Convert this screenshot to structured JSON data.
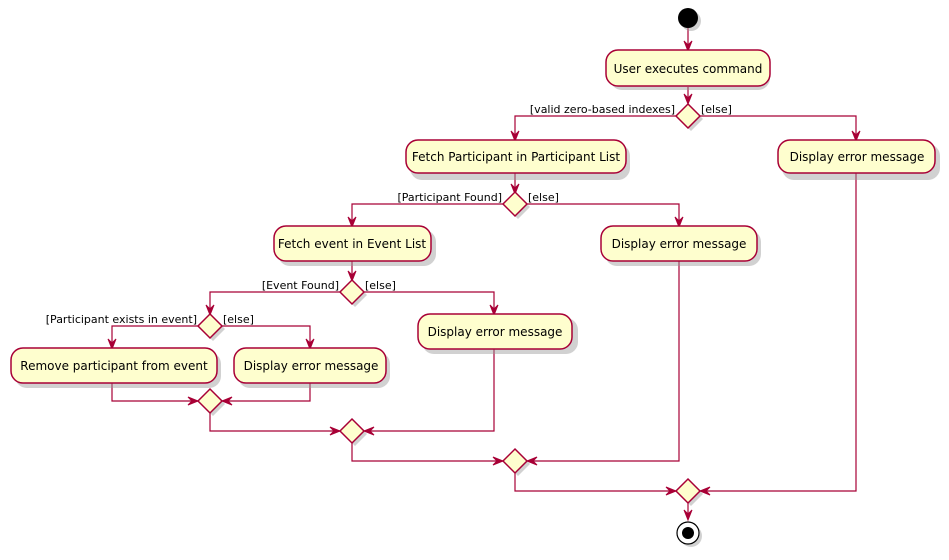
{
  "diagram": {
    "type": "activity",
    "colors": {
      "activity_fill": "#FEFECE",
      "border": "#A80036",
      "node": "#000000"
    },
    "activities": {
      "user_executes": "User executes command",
      "fetch_participant": "Fetch Participant in Participant List",
      "error_indexes": "Display error message",
      "fetch_event": "Fetch event in Event List",
      "error_participant": "Display error message",
      "error_event": "Display error message",
      "remove_participant": "Remove participant from event",
      "error_exists": "Display error message"
    },
    "guards": {
      "valid_indexes": "[valid zero-based indexes]",
      "else_1": "[else]",
      "participant_found": "[Participant Found]",
      "else_2": "[else]",
      "event_found": "[Event Found]",
      "else_3": "[else]",
      "participant_exists": "[Participant exists in event]",
      "else_4": "[else]"
    }
  }
}
